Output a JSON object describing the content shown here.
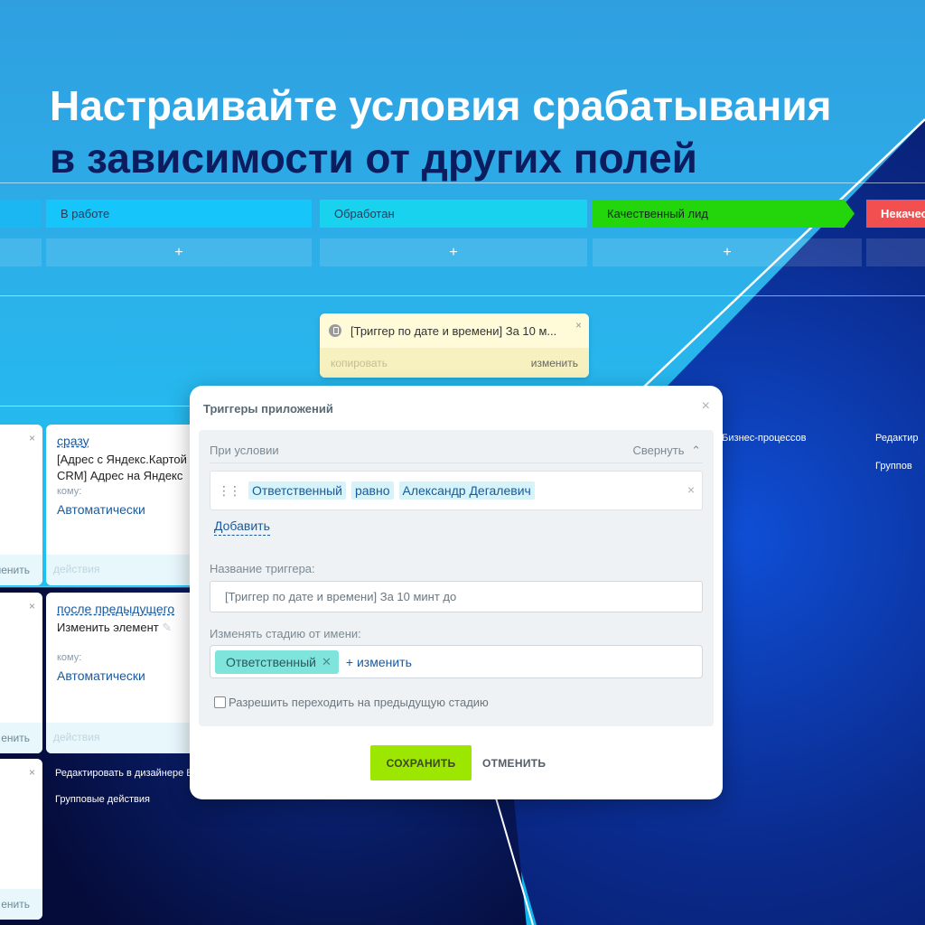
{
  "headline": {
    "line1": "Настраивайте условия срабатывания",
    "line2": "в зависимости от других полей"
  },
  "stages": [
    "В работе",
    "Обработан",
    "Качественный лид",
    "Некачес"
  ],
  "add_symbol": "+",
  "trigger_card": {
    "text": "[Триггер по дате и времени] За 10 м...",
    "close": "×",
    "copy_label": "копировать",
    "change_label": "изменить"
  },
  "left_cards": [
    {
      "close": "×",
      "footer": "менить"
    },
    {
      "close": "×",
      "footer": "енить"
    },
    {
      "close": "×",
      "footer": "енить"
    }
  ],
  "mid_cards": [
    {
      "link": "сразу",
      "line1": "[Адрес с Яндекс.Картой",
      "line2": "CRM] Адрес на Яндекс",
      "komu": "кому:",
      "auto": "Автоматически",
      "footer": "действия"
    },
    {
      "link": "после предыдущего",
      "line1": "Изменить элемент",
      "line2": "",
      "komu": "кому:",
      "auto": "Автоматически",
      "footer": "действия"
    }
  ],
  "side_links": {
    "edit_designer_left": "Редактировать в дизайнере Б",
    "group_actions_left": "Групповые действия",
    "bp_right": "е Бизнес-процессов",
    "edit_right": "Редактир",
    "group_right": "Группов"
  },
  "modal": {
    "title": "Триггеры приложений",
    "close": "×",
    "condition_label": "При условии",
    "collapse_label": "Свернуть",
    "condition": {
      "field": "Ответственный",
      "operator": "равно",
      "value": "Александр Дегалевич",
      "remove": "×"
    },
    "add_label": "Добавить",
    "name_label": "Название триггера:",
    "name_value": "[Триггер по дате и времени] За 10 минт до",
    "responsible_label": "Изменять стадию от имени:",
    "responsible_tag": "Ответственный",
    "responsible_change": "+ изменить",
    "allow_prev_label": "Разрешить переходить на предыдущую стадию",
    "allow_prev_checked": false,
    "save_label": "СОХРАНИТЬ",
    "cancel_label": "ОТМЕНИТЬ"
  },
  "colors": {
    "save_button": "#9de600",
    "qualified_lead": "#23d60c",
    "unqualified": "#f25050",
    "headline_dark": "#0b1d5e"
  }
}
